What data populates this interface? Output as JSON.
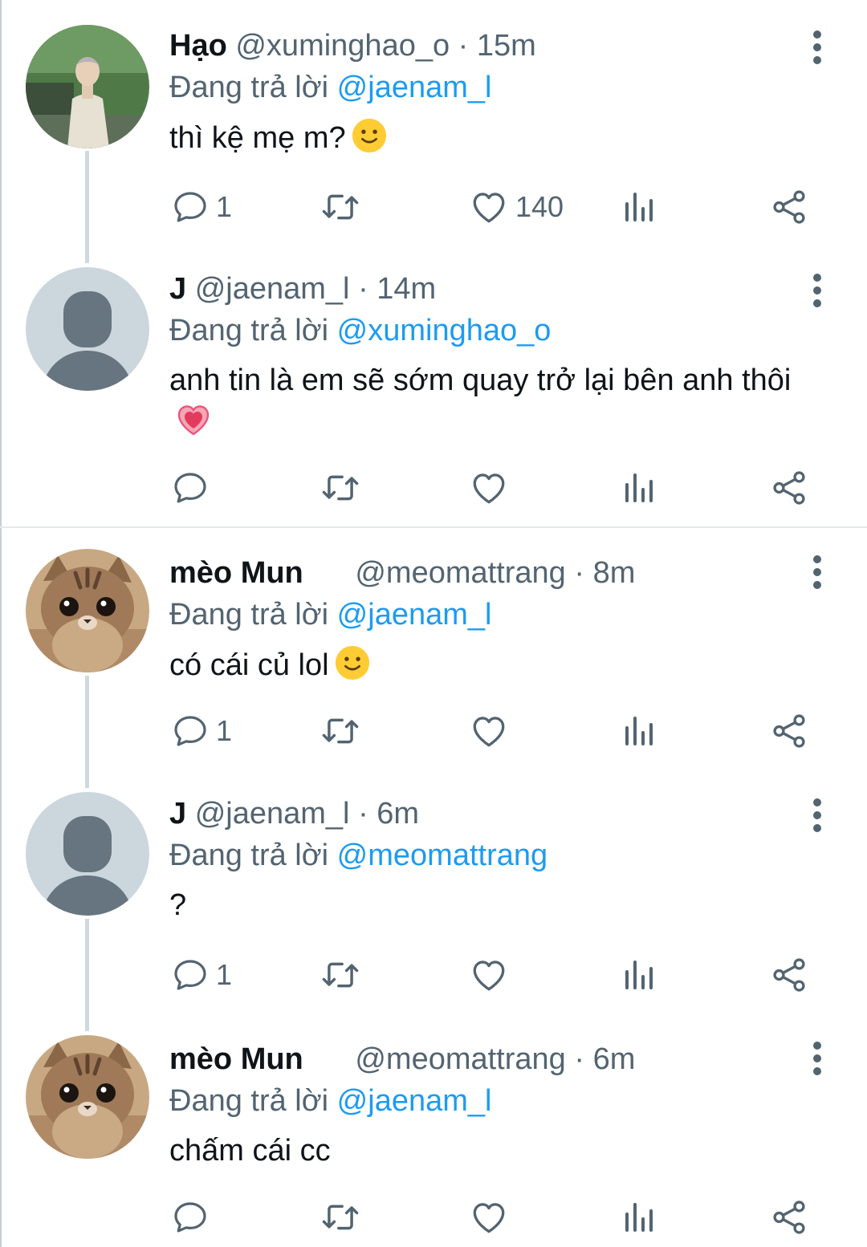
{
  "reply_prefix": "Đang trả lời",
  "tweets": [
    {
      "name": "Hạo",
      "handle": "@xuminghao_o",
      "time": "· 15m",
      "reply_to": "@jaenam_l",
      "text": "thì kệ mẹ m?",
      "counts": {
        "reply": "1",
        "like": "140"
      }
    },
    {
      "name": "J",
      "handle": "@jaenam_l",
      "time": "· 14m",
      "reply_to": "@xuminghao_o",
      "text": "anh tin là em sẽ sớm quay trở lại bên anh thôi",
      "counts": {
        "reply": "",
        "like": ""
      }
    },
    {
      "name": "mèo Mun",
      "handle": "@meomattrang",
      "time": "· 8m",
      "reply_to": "@jaenam_l",
      "text": "có cái củ lol",
      "counts": {
        "reply": "1",
        "like": ""
      }
    },
    {
      "name": "J",
      "handle": "@jaenam_l",
      "time": "· 6m",
      "reply_to": "@meomattrang",
      "text": "?",
      "counts": {
        "reply": "1",
        "like": ""
      }
    },
    {
      "name": "mèo Mun",
      "handle": "@meomattrang",
      "time": "· 6m",
      "reply_to": "@jaenam_l",
      "text": "chấm cái cc",
      "counts": {
        "reply": "",
        "like": ""
      }
    }
  ],
  "colors": {
    "mention": "#1d9bf0",
    "secondary_text": "#536471",
    "thread_line": "#cfd9de"
  },
  "icons": [
    "reply-icon",
    "retweet-icon",
    "like-icon",
    "analytics-icon",
    "share-icon",
    "more-icon"
  ]
}
